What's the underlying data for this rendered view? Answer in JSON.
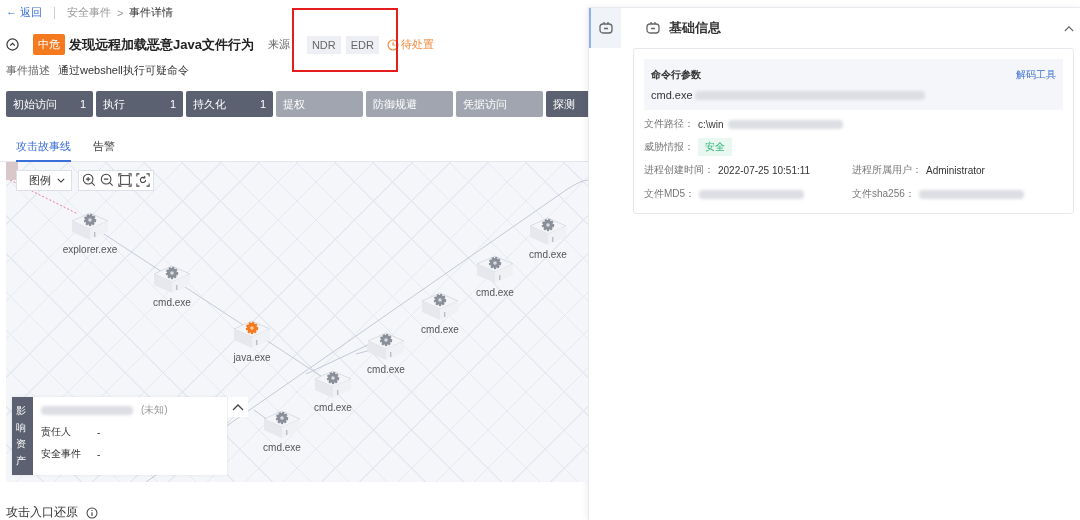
{
  "breadcrumb": {
    "back_icon": "←",
    "back": "返回",
    "path": "安全事件",
    "separator": ">",
    "current": "事件详情"
  },
  "event": {
    "severity": "中危",
    "title": "发现远程加载恶意Java文件行为",
    "source_label": "来源",
    "sources": [
      "NDR",
      "EDR"
    ],
    "sources_highlighted": true,
    "status": "待处置",
    "description_label": "事件描述",
    "description": "通过webshell执行可疑命令"
  },
  "tactics": [
    {
      "label": "初始访问",
      "count": "1",
      "active": true
    },
    {
      "label": "执行",
      "count": "1",
      "active": true
    },
    {
      "label": "持久化",
      "count": "1",
      "active": true
    },
    {
      "label": "提权",
      "active": false
    },
    {
      "label": "防御规避",
      "active": false
    },
    {
      "label": "凭据访问",
      "active": false
    },
    {
      "label": "探测",
      "active": true
    }
  ],
  "tabs": [
    {
      "label": "攻击故事线",
      "selected": true
    },
    {
      "label": "告警",
      "selected": false
    }
  ],
  "graph": {
    "legend": "图例",
    "nodes": [
      {
        "label": "explorer.exe",
        "kind": "process"
      },
      {
        "label": "cmd.exe",
        "kind": "process"
      },
      {
        "label": "java.exe",
        "kind": "alert"
      },
      {
        "label": "cmd.exe",
        "kind": "process"
      },
      {
        "label": "cmd.exe",
        "kind": "process"
      },
      {
        "label": "cmd.exe",
        "kind": "process"
      },
      {
        "label": "cmd.exe",
        "kind": "process"
      },
      {
        "label": "cmd.exe",
        "kind": "process"
      },
      {
        "label": "cmd.exe",
        "kind": "process"
      }
    ],
    "asset": {
      "heading": "影响资产",
      "ip_redacted": true,
      "ip_note": "(未知)",
      "fields": [
        {
          "label": "责任人",
          "value": "-"
        },
        {
          "label": "安全事件",
          "value": "-"
        }
      ]
    }
  },
  "section_title": "攻击入口还原",
  "panel": {
    "title": "基础信息",
    "command": {
      "label": "命令行参数",
      "link": "解码工具",
      "value": "cmd.exe",
      "redacted": true
    },
    "path": {
      "label": "文件路径：",
      "value": "c:\\win",
      "redacted": true
    },
    "intel": {
      "label": "威胁情报：",
      "value": "安全"
    },
    "fields": [
      {
        "label": "进程创建时间：",
        "value": "2022-07-25 10:51:11"
      },
      {
        "label": "进程所属用户：",
        "value": "Administrator"
      },
      {
        "label": "文件MD5：",
        "redacted": true
      },
      {
        "label": "文件sha256：",
        "redacted": true
      }
    ]
  }
}
